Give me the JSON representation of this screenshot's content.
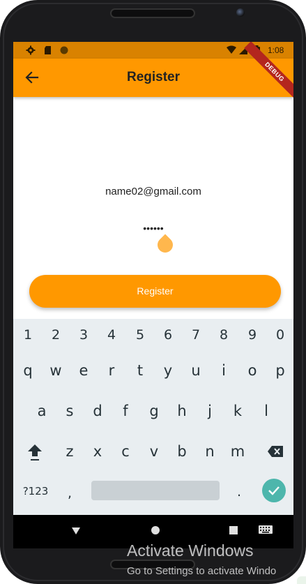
{
  "status_bar": {
    "time": "1:08",
    "bar_color": "#d98200",
    "icons": [
      "gear-icon",
      "sd-card-icon",
      "circle-icon",
      "wifi-icon",
      "signal-icon",
      "battery-icon"
    ]
  },
  "app_bar": {
    "title": "Register",
    "back_icon": "arrow-left-icon",
    "debug_banner": "DEBUG",
    "color": "#ff9800"
  },
  "form": {
    "email_value": "name02@gmail.com",
    "password_value": "••••••",
    "register_label": "Register",
    "button_color": "#ff9800"
  },
  "keyboard": {
    "number_row": [
      "1",
      "2",
      "3",
      "4",
      "5",
      "6",
      "7",
      "8",
      "9",
      "0"
    ],
    "row1": [
      "q",
      "w",
      "e",
      "r",
      "t",
      "y",
      "u",
      "i",
      "o",
      "p"
    ],
    "row2": [
      "a",
      "s",
      "d",
      "f",
      "g",
      "h",
      "j",
      "k",
      "l"
    ],
    "row3": [
      "z",
      "x",
      "c",
      "v",
      "b",
      "n",
      "m"
    ],
    "symbols_label": "?123",
    "comma": ",",
    "period": ".",
    "shift_icon": "shift-icon",
    "backspace_icon": "backspace-icon",
    "enter_icon": "checkmark-icon",
    "accent": "#4db6ac"
  },
  "nav_bar": {
    "back_icon": "triangle-back-icon",
    "home_icon": "circle-home-icon",
    "recents_icon": "square-recents-icon",
    "keyboard_icon": "keyboard-icon"
  },
  "watermark": {
    "title": "Activate Windows",
    "subtitle": "Go to Settings to activate Windo"
  }
}
